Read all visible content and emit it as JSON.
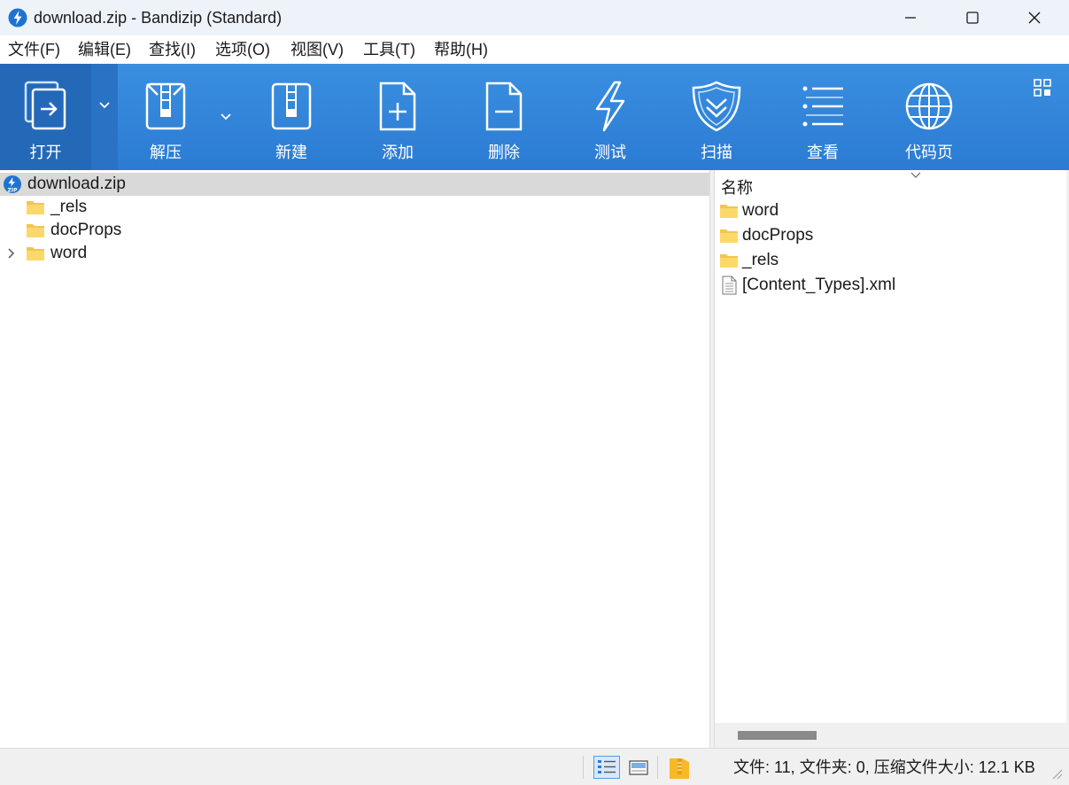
{
  "window": {
    "title": "download.zip - Bandizip (Standard)",
    "controls": [
      "minimize",
      "maximize",
      "close"
    ]
  },
  "menu": [
    "文件(F)",
    "编辑(E)",
    "查找(I)",
    "选项(O)",
    "视图(V)",
    "工具(T)",
    "帮助(H)"
  ],
  "toolbar": {
    "open": "打开",
    "extract": "解压",
    "new": "新建",
    "add": "添加",
    "delete": "删除",
    "test": "测试",
    "scan": "扫描",
    "view": "查看",
    "codepage": "代码页"
  },
  "tree": {
    "root": "download.zip",
    "items": [
      {
        "name": "_rels",
        "expandable": false
      },
      {
        "name": "docProps",
        "expandable": false
      },
      {
        "name": "word",
        "expandable": true
      }
    ]
  },
  "list": {
    "column_name": "名称",
    "items": [
      {
        "name": "word",
        "type": "folder"
      },
      {
        "name": "docProps",
        "type": "folder"
      },
      {
        "name": "_rels",
        "type": "folder"
      },
      {
        "name": "[Content_Types].xml",
        "type": "file"
      }
    ]
  },
  "status": {
    "summary": "文件: 11, 文件夹: 0, 压缩文件大小: 12.1 KB"
  },
  "colors": {
    "toolbar": "#2b7bd3",
    "toolbar_open": "#2469b8",
    "selected_row": "#d9d9d9",
    "folder": "#f7c948"
  }
}
